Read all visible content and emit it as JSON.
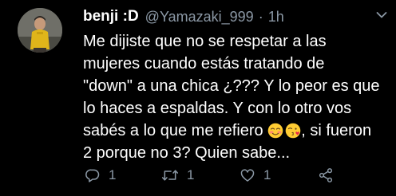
{
  "tweet": {
    "author": {
      "display_name": "benji :D",
      "handle": "@Yamazaki_999",
      "separator": "·",
      "time": "1h"
    },
    "text": {
      "line1": "Me dijiste que no se respetar a las",
      "line2": "mujeres cuando estás tratando de",
      "line3": "\"down\" a una chica ¿??? Y lo peor es que",
      "line4": "lo haces a espaldas. Y con lo otro vos",
      "line5a": "sabés a lo que me refiero ",
      "line5b": ", si fueron",
      "line6": "2 porque no 3? Quien sabe..."
    },
    "emojis": [
      "smirking-blushing-face",
      "face-blowing-kiss"
    ],
    "actions": {
      "reply_count": "1",
      "retweet_count": "1",
      "like_count": "1"
    },
    "icons": [
      "avatar-photo",
      "chevron-down-icon",
      "reply-icon",
      "retweet-icon",
      "like-icon",
      "share-icon"
    ],
    "colors": {
      "background": "#000000",
      "text": "#ffffff",
      "secondary": "#8b98a5"
    }
  }
}
